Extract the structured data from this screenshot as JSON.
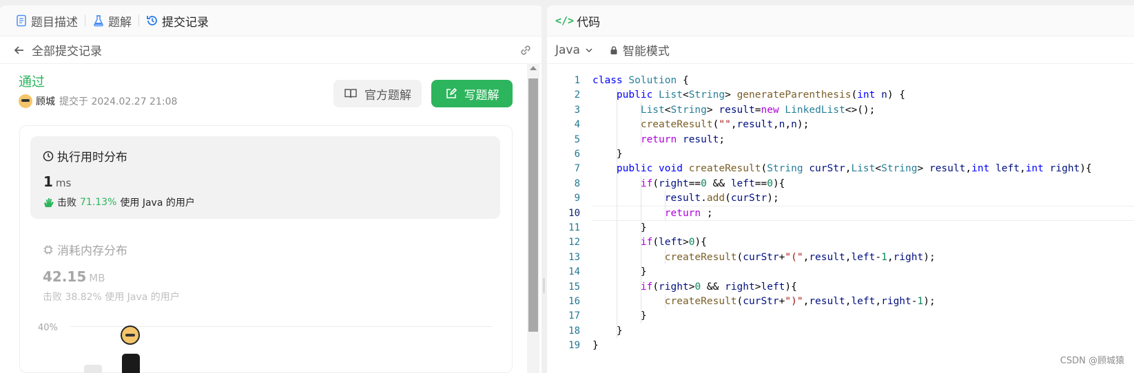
{
  "left_tabs": [
    {
      "label": "题目描述",
      "icon": "document-icon",
      "color": "#4a8df6"
    },
    {
      "label": "题解",
      "icon": "flask-icon",
      "color": "#4a8df6"
    },
    {
      "label": "提交记录",
      "icon": "history-icon",
      "color": "#1a73e8"
    }
  ],
  "subheader": {
    "title": "全部提交记录",
    "back_icon": "arrow-left-icon",
    "link_icon": "link-icon"
  },
  "submission": {
    "status": "通过",
    "user": "顾城",
    "submitted_text": "提交于 2024.02.27 21:08"
  },
  "buttons": {
    "official": "官方题解",
    "write": "写题解"
  },
  "runtime": {
    "title": "执行用时分布",
    "value": "1",
    "unit": "ms",
    "beat_prefix": "击败",
    "beat_pct": "71.13%",
    "beat_suffix": "使用 Java 的用户"
  },
  "memory": {
    "title": "消耗内存分布",
    "value": "42.15",
    "unit": "MB",
    "beat_text": "击败 38.82% 使用 Java 的用户"
  },
  "chart": {
    "tick_label": "40%"
  },
  "right_header": {
    "icon_text": "</>",
    "title": "代码"
  },
  "toolbar": {
    "language": "Java",
    "mode": "智能模式"
  },
  "code_lines": [
    {
      "n": "1",
      "html": "<span class='kw'>class</span> <span class='ty'>Solution</span> {"
    },
    {
      "n": "2",
      "html": "    <span class='kw'>public</span> <span class='ty'>List</span>&lt;<span class='ty'>String</span>&gt; <span class='fn'>generateParenthesis</span>(<span class='kw'>int</span> <span class='vr'>n</span>) {"
    },
    {
      "n": "3",
      "html": "        <span class='ty'>List</span>&lt;<span class='ty'>String</span>&gt; <span class='vr'>result</span>=<span class='kw2'>new</span> <span class='ty'>LinkedList</span>&lt;&gt;();"
    },
    {
      "n": "4",
      "html": "        <span class='fn'>createResult</span>(<span class='st'>\"\"</span>,<span class='vr'>result</span>,<span class='vr'>n</span>,<span class='vr'>n</span>);"
    },
    {
      "n": "5",
      "html": "        <span class='kw2'>return</span> <span class='vr'>result</span>;"
    },
    {
      "n": "6",
      "html": "    }"
    },
    {
      "n": "7",
      "html": "    <span class='kw'>public</span> <span class='kw'>void</span> <span class='fn'>createResult</span>(<span class='ty'>String</span> <span class='vr'>curStr</span>,<span class='ty'>List</span>&lt;<span class='ty'>String</span>&gt; <span class='vr'>result</span>,<span class='kw'>int</span> <span class='vr'>left</span>,<span class='kw'>int</span> <span class='vr'>right</span>){"
    },
    {
      "n": "8",
      "html": "        <span class='kw2'>if</span>(<span class='vr'>right</span>==<span class='nm'>0</span> &amp;&amp; <span class='vr'>left</span>==<span class='nm'>0</span>){"
    },
    {
      "n": "9",
      "html": "            <span class='vr'>result</span>.<span class='fn'>add</span>(<span class='vr'>curStr</span>);"
    },
    {
      "n": "10",
      "html": "            <span class='kw2'>return</span> ;"
    },
    {
      "n": "11",
      "html": "        }"
    },
    {
      "n": "12",
      "html": "        <span class='kw2'>if</span>(<span class='vr'>left</span>&gt;<span class='nm'>0</span>){"
    },
    {
      "n": "13",
      "html": "            <span class='fn'>createResult</span>(<span class='vr'>curStr</span>+<span class='st'>\"(\"</span>,<span class='vr'>result</span>,<span class='vr'>left</span>-<span class='nm'>1</span>,<span class='vr'>right</span>);"
    },
    {
      "n": "14",
      "html": "        }"
    },
    {
      "n": "15",
      "html": "        <span class='kw2'>if</span>(<span class='vr'>right</span>&gt;<span class='nm'>0</span> &amp;&amp; <span class='vr'>right</span>&gt;<span class='vr'>left</span>){"
    },
    {
      "n": "16",
      "html": "            <span class='fn'>createResult</span>(<span class='vr'>curStr</span>+<span class='st'>\")\"</span>,<span class='vr'>result</span>,<span class='vr'>left</span>,<span class='vr'>right</span>-<span class='nm'>1</span>);"
    },
    {
      "n": "17",
      "html": "        }"
    },
    {
      "n": "18",
      "html": "    }"
    },
    {
      "n": "19",
      "html": "}"
    }
  ],
  "current_line": "10",
  "watermark": "CSDN @顾城猿",
  "colors": {
    "accent_green": "#2db55d",
    "tab_blue": "#4a8df6"
  }
}
